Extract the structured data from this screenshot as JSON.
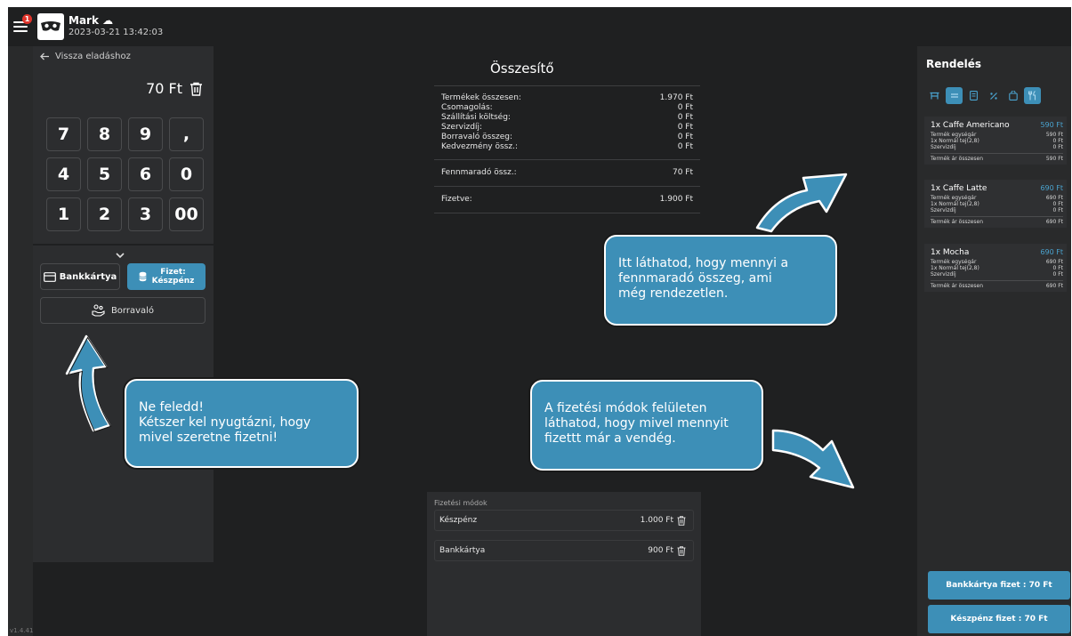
{
  "header": {
    "badge_count": "1",
    "user_name": "Mark",
    "datetime": "2023-03-21  13:42:03",
    "version": "v1.4.41"
  },
  "left_panel": {
    "back_label": "Vissza eladáshoz",
    "amount": "70 Ft",
    "keys": [
      "7",
      "8",
      "9",
      ",",
      "4",
      "5",
      "6",
      "0",
      "1",
      "2",
      "3",
      "00"
    ],
    "card_button": "Bankkártya",
    "cash_button_line1": "Fizet:",
    "cash_button_line2": "Készpénz",
    "tip_button": "Borravaló"
  },
  "summary": {
    "title": "Összesítő",
    "rows": [
      {
        "label": "Termékek összesen:",
        "value": "1.970 Ft"
      },
      {
        "label": "Csomagolás:",
        "value": "0 Ft"
      },
      {
        "label": "Szállítási költség:",
        "value": "0 Ft"
      },
      {
        "label": "Szervizdíj:",
        "value": "0 Ft"
      },
      {
        "label": "Borravaló összeg:",
        "value": "0 Ft"
      },
      {
        "label": "Kedvezmény össz.:",
        "value": "0 Ft"
      }
    ],
    "remaining_label": "Fennmaradó össz.:",
    "remaining_value": "70 Ft",
    "paid_label": "Fizetve:",
    "paid_value": "1.900 Ft"
  },
  "payment_methods": {
    "title": "Fizetési módok",
    "items": [
      {
        "label": "Készpénz",
        "value": "1.000 Ft"
      },
      {
        "label": "Bankkártya",
        "value": "900 Ft"
      }
    ]
  },
  "order": {
    "title": "Rendelés",
    "items": [
      {
        "name": "1x Caffe Americano",
        "price": "590 Ft",
        "unit_label": "Termék egységár",
        "unit_value": "590 Ft",
        "extra_label": "1x Normál tej(2,8)",
        "extra_value": "0 Ft",
        "service_label": "Szervizdíj",
        "service_value": "0 Ft",
        "total_label": "Termék ár összesen",
        "total_value": "590 Ft"
      },
      {
        "name": "1x Caffe Latte",
        "price": "690 Ft",
        "unit_label": "Termék egységár",
        "unit_value": "690 Ft",
        "extra_label": "1x Normál tej(2,8)",
        "extra_value": "0 Ft",
        "service_label": "Szervizdíj",
        "service_value": "0 Ft",
        "total_label": "Termék ár összesen",
        "total_value": "690 Ft"
      },
      {
        "name": "1x Mocha",
        "price": "690 Ft",
        "unit_label": "Termék egységár",
        "unit_value": "690 Ft",
        "extra_label": "1x Normál tej(2,8)",
        "extra_value": "0 Ft",
        "service_label": "Szervizdíj",
        "service_value": "0 Ft",
        "total_label": "Termék ár összesen",
        "total_value": "690 Ft"
      }
    ],
    "pay_card_button": "Bankkártya fizet : 70 Ft",
    "pay_cash_button": "Készpénz fizet : 70 Ft"
  },
  "callouts": {
    "left_line1": "Ne feledd!",
    "left_line2": "Kétszer kel nyugtázni, hogy",
    "left_line3": "mivel szeretne fizetni!",
    "top_line1": "Itt láthatod, hogy mennyi a",
    "top_line2": "fennmaradó összeg, ami",
    "top_line3": "még rendezetlen.",
    "bottom_line1": "A fizetési módok felületen",
    "bottom_line2": "láthatod, hogy mivel mennyit",
    "bottom_line3": "fizettt már a vendég."
  },
  "colors": {
    "accent": "#3d8fb7",
    "background": "#1f2021",
    "panel": "#2c2d2f",
    "badge": "#e0342b"
  }
}
